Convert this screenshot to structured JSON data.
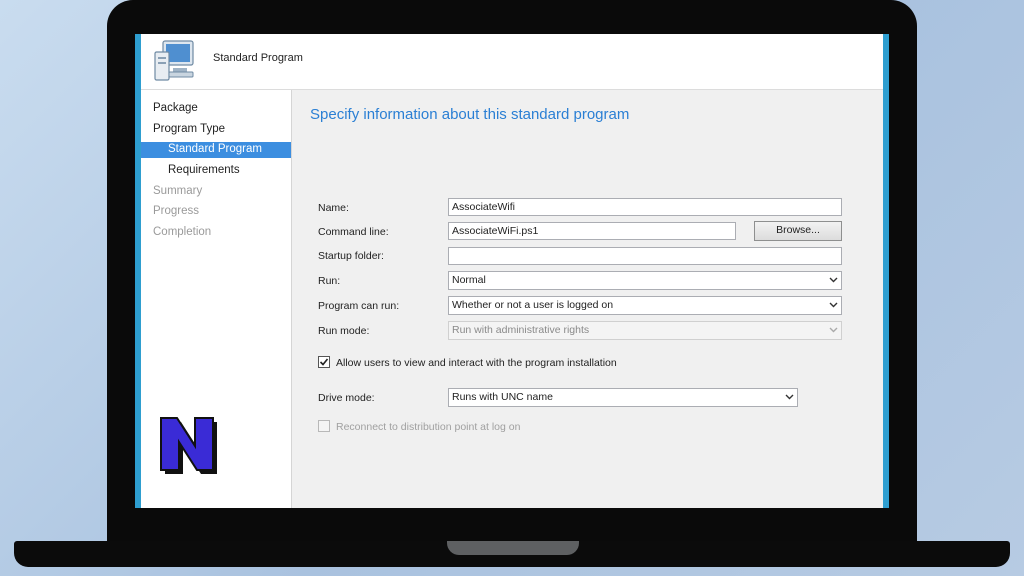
{
  "dialog": {
    "title": "Standard Program"
  },
  "nav": {
    "items": [
      {
        "label": "Package",
        "state": "normal"
      },
      {
        "label": "Program Type",
        "state": "normal"
      },
      {
        "label": "Standard Program",
        "state": "selected"
      },
      {
        "label": "Requirements",
        "state": "normal"
      },
      {
        "label": "Summary",
        "state": "disabled"
      },
      {
        "label": "Progress",
        "state": "disabled"
      },
      {
        "label": "Completion",
        "state": "disabled"
      }
    ]
  },
  "form": {
    "heading": "Specify information about this standard program",
    "name": {
      "label": "Name:",
      "value": "AssociateWifi"
    },
    "command_line": {
      "label": "Command line:",
      "value": "AssociateWiFi.ps1",
      "browse_label": "Browse..."
    },
    "startup_folder": {
      "label": "Startup folder:",
      "value": ""
    },
    "run": {
      "label": "Run:",
      "value": "Normal"
    },
    "program_can_run": {
      "label": "Program can run:",
      "value": "Whether or not a user is logged on"
    },
    "run_mode": {
      "label": "Run mode:",
      "value": "Run with administrative rights"
    },
    "allow_interact": {
      "label": "Allow users to view and interact with the program installation",
      "checked": true
    },
    "drive_mode": {
      "label": "Drive mode:",
      "value": "Runs with UNC name"
    },
    "reconnect": {
      "label": "Reconnect to distribution point at log on",
      "checked": false
    }
  },
  "colors": {
    "heading": "#2a7fd4",
    "selection": "#3c8ee0",
    "window_border": "#2e9ed0",
    "logo_fill": "#3a2bd6"
  },
  "icons": [
    "computer-icon",
    "chevron-down-icon",
    "check-icon",
    "n-logo-icon"
  ]
}
